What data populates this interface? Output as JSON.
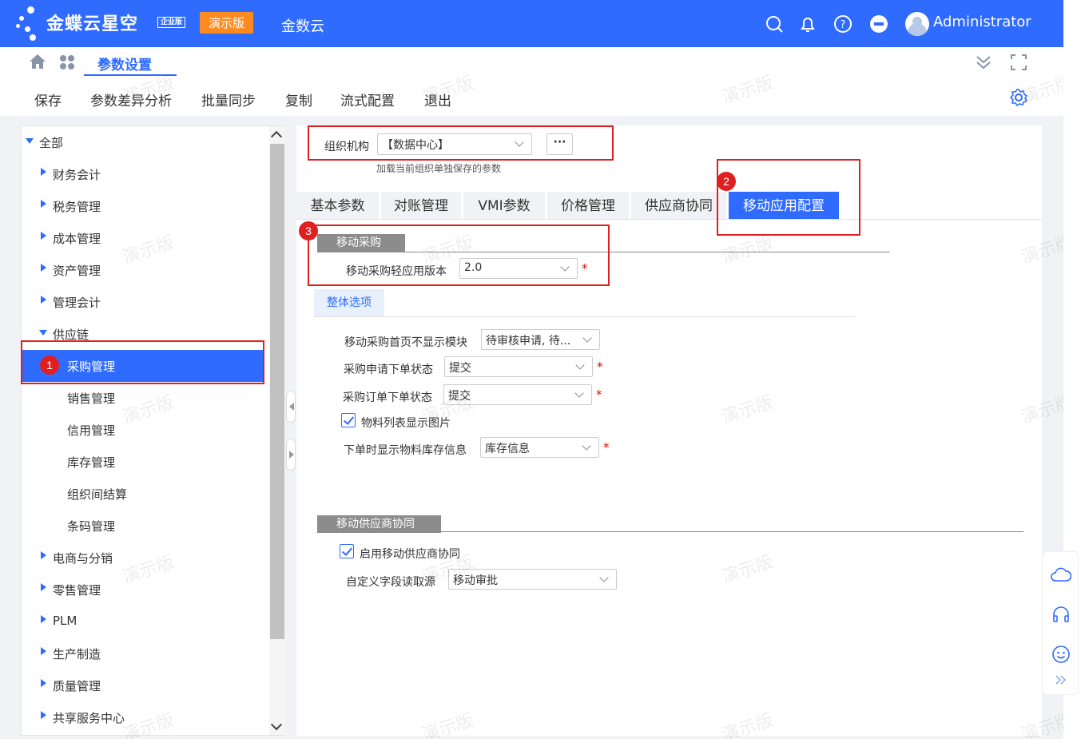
{
  "topbar": {
    "brand": "金蝶云星空",
    "brand_tag": "企业版",
    "demo_badge": "演示版",
    "jinshuyun": "金数云",
    "username": "Administrator"
  },
  "tabs": {
    "active_label": "参数设置",
    "close": "×"
  },
  "toolbar": {
    "save": "保存",
    "diff": "参数差异分析",
    "batch_sync": "批量同步",
    "copy": "复制",
    "flow": "流式配置",
    "exit": "退出"
  },
  "tree": {
    "items": [
      {
        "label": "全部"
      },
      {
        "label": "财务会计"
      },
      {
        "label": "税务管理"
      },
      {
        "label": "成本管理"
      },
      {
        "label": "资产管理"
      },
      {
        "label": "管理会计"
      },
      {
        "label": "供应链"
      },
      {
        "label": "采购管理"
      },
      {
        "label": "销售管理"
      },
      {
        "label": "信用管理"
      },
      {
        "label": "库存管理"
      },
      {
        "label": "组织间结算"
      },
      {
        "label": "条码管理"
      },
      {
        "label": "电商与分销"
      },
      {
        "label": "零售管理"
      },
      {
        "label": "PLM"
      },
      {
        "label": "生产制造"
      },
      {
        "label": "质量管理"
      },
      {
        "label": "共享服务中心"
      }
    ]
  },
  "org": {
    "label": "组织机构",
    "value": "【数据中心】",
    "more": "···",
    "hint": "加载当前组织单独保存的参数"
  },
  "param_tabs": [
    "基本参数",
    "对账管理",
    "VMI参数",
    "价格管理",
    "供应商协同",
    "移动应用配置"
  ],
  "mobile_purchase": {
    "section_title": "移动采购",
    "light_version_label": "移动采购轻应用版本",
    "light_version_value": "2.0",
    "overall_tab": "整体选项",
    "home_hide_label": "移动采购首页不显示模块",
    "home_hide_value": "待审核申请, 待...",
    "req_status_label": "采购申请下单状态",
    "req_status_value": "提交",
    "order_status_label": "采购订单下单状态",
    "order_status_value": "提交",
    "show_image_label": "物料列表显示图片",
    "stock_info_label": "下单时显示物料库存信息",
    "stock_info_value": "库存信息"
  },
  "mobile_supplier": {
    "section_title": "移动供应商协同",
    "enable_label": "启用移动供应商协同",
    "custom_field_label": "自定义字段读取源",
    "custom_field_value": "移动审批"
  },
  "annotations": [
    "1",
    "2",
    "3"
  ],
  "required_mark": "*",
  "watermark": "演示版",
  "colors": {
    "primary": "#2f6bff",
    "demo_badge": "#ff8a1f",
    "annotation_red": "#e02020",
    "section_grey": "#8c8c8c"
  }
}
